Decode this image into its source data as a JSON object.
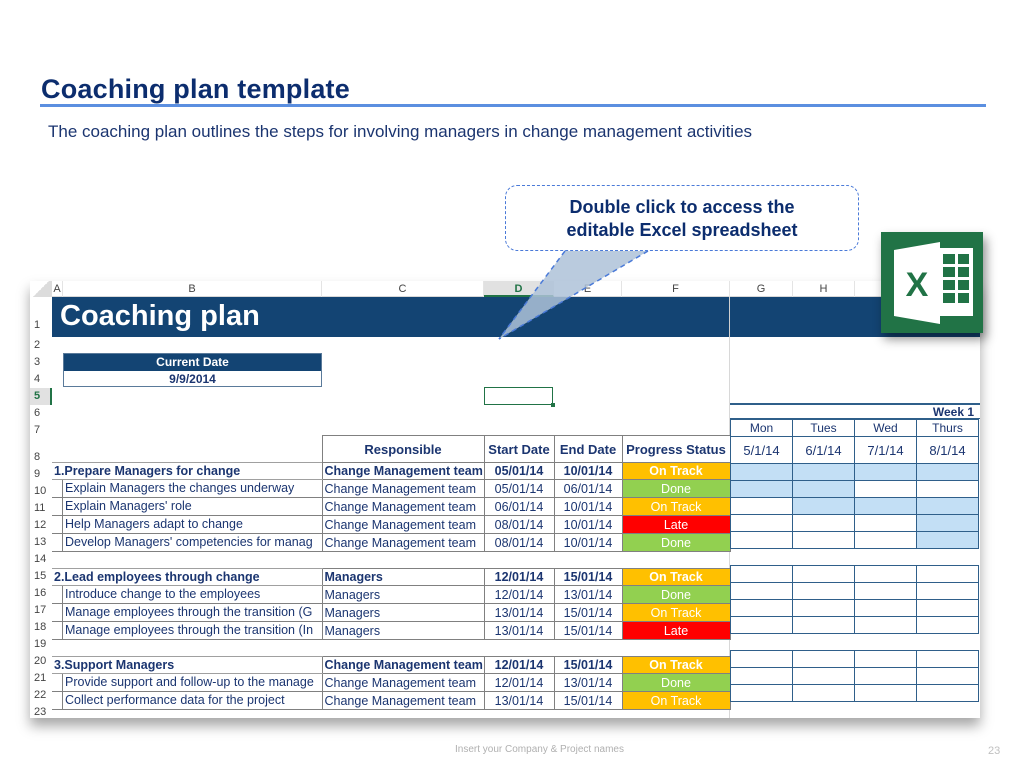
{
  "slide": {
    "title": "Coaching plan template",
    "subtitle": "The coaching plan outlines the steps for involving managers in change management activities",
    "callout": {
      "line1": "Double click to access the",
      "line2": "editable Excel spreadsheet"
    },
    "excel_icon": "excel-icon",
    "footer": "Insert your Company & Project names",
    "page_number": "23"
  },
  "sheet": {
    "columns": [
      "A",
      "B",
      "C",
      "D",
      "E",
      "F",
      "G",
      "H"
    ],
    "selected_column": "D",
    "row_numbers": [
      "1",
      "2",
      "3",
      "4",
      "5",
      "6",
      "7",
      "8",
      "9",
      "10",
      "11",
      "12",
      "13",
      "14",
      "15",
      "16",
      "17",
      "18",
      "19",
      "20",
      "21",
      "22",
      "23"
    ],
    "selected_row": "5",
    "banner_title": "Coaching plan",
    "current_date_label": "Current Date",
    "current_date_value": "9/9/2014",
    "headers": {
      "task": "",
      "responsible": "Responsible",
      "start": "Start Date",
      "end": "End Date",
      "status": "Progress Status"
    },
    "colors": {
      "banner": "#134473",
      "on_track": "#ffc000",
      "done": "#92d050",
      "late": "#ff0000",
      "gantt_fill": "#c3dff5",
      "excel_green": "#217346"
    },
    "sections": [
      {
        "title": "1.Prepare Managers for change",
        "responsible": "Change Management team",
        "start": "05/01/14",
        "end": "10/01/14",
        "status": "On Track",
        "gantt": [
          1,
          1,
          1,
          1
        ],
        "tasks": [
          {
            "task": "Explain Managers the changes underway",
            "responsible": "Change Management team",
            "start": "05/01/14",
            "end": "06/01/14",
            "status": "Done",
            "gantt": [
              1,
              1,
              0,
              0
            ]
          },
          {
            "task": "Explain Managers' role",
            "responsible": "Change Management team",
            "start": "06/01/14",
            "end": "10/01/14",
            "status": "On Track",
            "gantt": [
              0,
              1,
              1,
              1
            ]
          },
          {
            "task": "Help Managers adapt to change",
            "responsible": "Change Management team",
            "start": "08/01/14",
            "end": "10/01/14",
            "status": "Late",
            "gantt": [
              0,
              0,
              0,
              1
            ]
          },
          {
            "task": "Develop Managers' competencies for manag",
            "responsible": "Change Management team",
            "start": "08/01/14",
            "end": "10/01/14",
            "status": "Done",
            "gantt": [
              0,
              0,
              0,
              1
            ]
          }
        ]
      },
      {
        "title": "2.Lead employees through change",
        "responsible": "Managers",
        "start": "12/01/14",
        "end": "15/01/14",
        "status": "On Track",
        "gantt": [
          0,
          0,
          0,
          0
        ],
        "tasks": [
          {
            "task": "Introduce change to the employees",
            "responsible": "Managers",
            "start": "12/01/14",
            "end": "13/01/14",
            "status": "Done",
            "gantt": [
              0,
              0,
              0,
              0
            ]
          },
          {
            "task": "Manage employees through the transition (G",
            "responsible": "Managers",
            "start": "13/01/14",
            "end": "15/01/14",
            "status": "On Track",
            "gantt": [
              0,
              0,
              0,
              0
            ]
          },
          {
            "task": "Manage employees through the transition (In",
            "responsible": "Managers",
            "start": "13/01/14",
            "end": "15/01/14",
            "status": "Late",
            "gantt": [
              0,
              0,
              0,
              0
            ]
          }
        ]
      },
      {
        "title": "3.Support Managers",
        "responsible": "Change Management team",
        "start": "12/01/14",
        "end": "15/01/14",
        "status": "On Track",
        "gantt": [
          0,
          0,
          0,
          0
        ],
        "tasks": [
          {
            "task": "Provide support and follow-up to the manage",
            "responsible": "Change Management team",
            "start": "12/01/14",
            "end": "13/01/14",
            "status": "Done",
            "gantt": [
              0,
              0,
              0,
              0
            ]
          },
          {
            "task": "Collect performance data for the project",
            "responsible": "Change Management team",
            "start": "13/01/14",
            "end": "15/01/14",
            "status": "On Track",
            "gantt": [
              0,
              0,
              0,
              0
            ]
          }
        ]
      }
    ],
    "gantt": {
      "week_label": "Week 1",
      "days": [
        "Mon",
        "Tues",
        "Wed",
        "Thurs"
      ],
      "dates": [
        "5/1/14",
        "6/1/14",
        "7/1/14",
        "8/1/14"
      ]
    }
  }
}
